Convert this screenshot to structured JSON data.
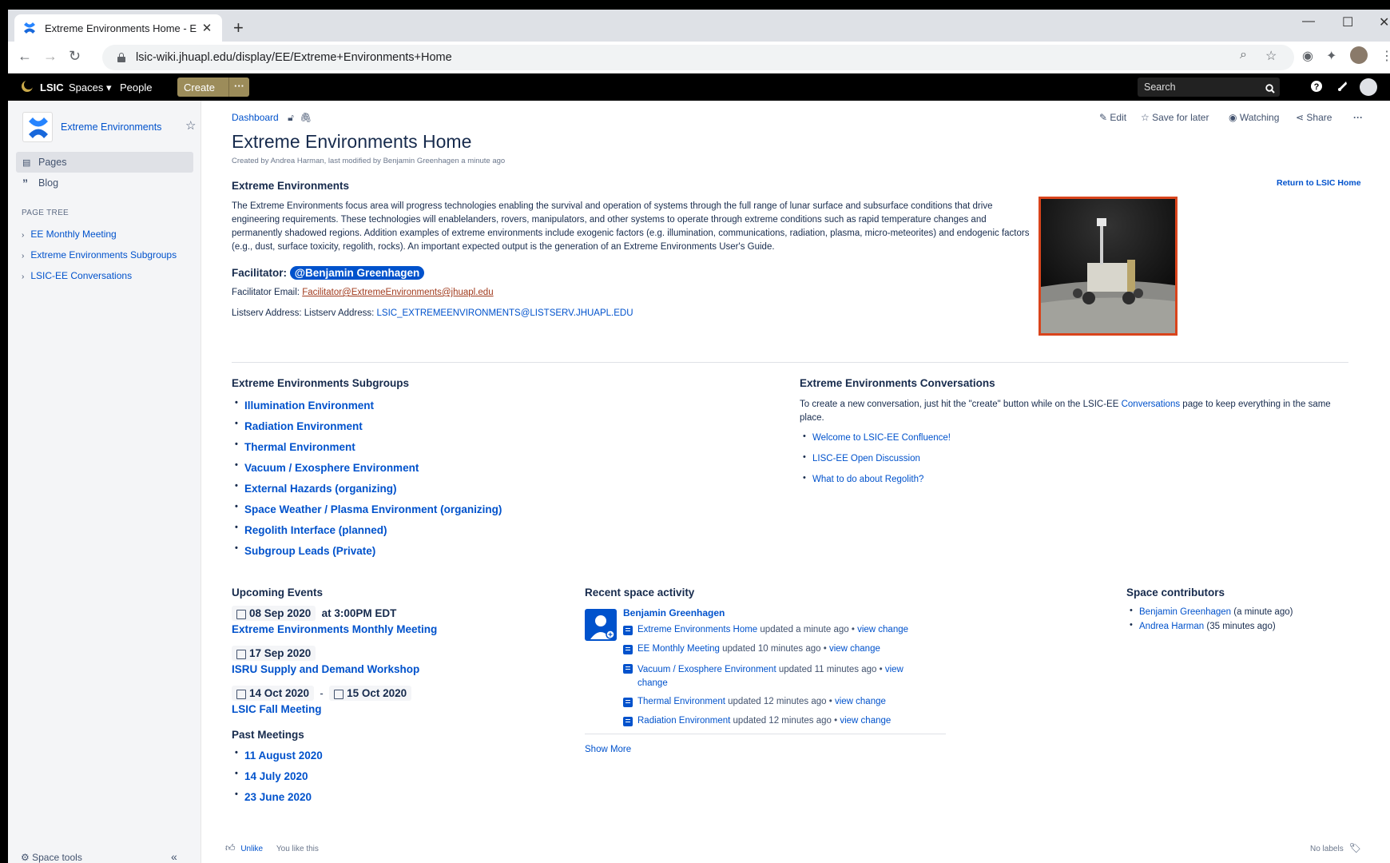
{
  "browser": {
    "tab_title": "Extreme Environments Home - E",
    "url": "lsic-wiki.jhuapl.edu/display/EE/Extreme+Environments+Home"
  },
  "topnav": {
    "logo_text": "LSIC",
    "spaces": "Spaces",
    "people": "People",
    "create": "Create",
    "more": "···",
    "search_placeholder": "Search"
  },
  "sidebar": {
    "space_name": "Extreme Environments",
    "pages": "Pages",
    "blog": "Blog",
    "page_tree_heading": "PAGE TREE",
    "tree": [
      "EE Monthly Meeting",
      "Extreme Environments Subgroups",
      "LSIC-EE Conversations"
    ],
    "space_tools": "Space tools"
  },
  "page": {
    "breadcrumb": "Dashboard",
    "tools": {
      "edit": "Edit",
      "save": "Save for later",
      "watch": "Watching",
      "share": "Share",
      "more": "···"
    },
    "title": "Extreme Environments Home",
    "byline": "Created by Andrea Harman, last modified by Benjamin Greenhagen a minute ago",
    "section_heading": "Extreme Environments",
    "return_link": "Return to LSIC Home",
    "description": "The Extreme Environments focus area will progress technologies enabling the survival and operation of systems through the full range of lunar surface and subsurface conditions that drive engineering requirements. These technologies will enablelanders, rovers, manipulators, and other systems to operate through extreme conditions such as rapid temperature changes and permanently shadowed regions. Addition examples of extreme environments include exogenic factors (e.g. illumination, communications, radiation, plasma, micro-meteorites) and endogenic factors (e.g., dust, surface toxicity, regolith, rocks). An important expected output is the generation of an Extreme Environments User's Guide.",
    "facilitator_label": "Facilitator:",
    "facilitator_mention": "@Benjamin Greenhagen",
    "facilitator_email_label": "Facilitator Email:",
    "facilitator_email": "Facilitator@ExtremeEnvironments@jhuapl.edu",
    "listserv_label": "Listserv Address: Listserv Address:",
    "listserv": "LSIC_EXTREMEENVIRONMENTS@LISTSERV.JHUAPL.EDU"
  },
  "subgroups": {
    "heading": "Extreme Environments Subgroups",
    "items": [
      "Illumination Environment",
      "Radiation Environment",
      "Thermal Environment",
      "Vacuum / Exosphere Environment",
      "External Hazards (organizing)",
      "Space Weather / Plasma Environment (organizing)",
      "Regolith Interface (planned)",
      "Subgroup Leads (Private)"
    ]
  },
  "conversations": {
    "heading": "Extreme Environments Conversations",
    "intro_a": "To create a new conversation, just hit the \"create\" button while on the LSIC-EE ",
    "intro_link": "Conversations",
    "intro_b": " page to keep everything in the same place.",
    "items": [
      "Welcome to LSIC-EE Confluence!",
      "LISC-EE Open Discussion",
      "What to do about Regolith?"
    ]
  },
  "events": {
    "heading": "Upcoming Events",
    "e1_date": "08 Sep 2020",
    "e1_time": "at 3:00PM EDT",
    "e1_title": "Extreme Environments Monthly Meeting",
    "e2_date": "17 Sep 2020",
    "e2_title": "ISRU Supply and Demand Workshop",
    "e3_date_start": "14 Oct 2020",
    "e3_sep": "-",
    "e3_date_end": "15 Oct 2020",
    "e3_title": "LSIC Fall Meeting",
    "past_heading": "Past Meetings",
    "past": [
      "11 August 2020",
      "14 July 2020",
      "23 June 2020"
    ]
  },
  "activity": {
    "heading": "Recent space activity",
    "user": "Benjamin Greenhagen",
    "rows": [
      {
        "page": "Extreme Environments Home",
        "when": " updated a minute ago • ",
        "action": "view change"
      },
      {
        "page": "EE Monthly Meeting",
        "when": " updated 10 minutes ago • ",
        "action": "view change"
      },
      {
        "page": "Vacuum / Exosphere Environment",
        "when": " updated 11 minutes ago • ",
        "action": "view change"
      },
      {
        "page": "Thermal Environment",
        "when": " updated 12 minutes ago • ",
        "action": "view change"
      },
      {
        "page": "Radiation Environment",
        "when": " updated 12 minutes ago • ",
        "action": "view change"
      }
    ],
    "show_more": "Show More"
  },
  "contributors": {
    "heading": "Space contributors",
    "items": [
      {
        "name": "Benjamin Greenhagen",
        "when": " (a minute ago)"
      },
      {
        "name": "Andrea Harman",
        "when": " (35 minutes ago)"
      }
    ]
  },
  "footer": {
    "like": "Unlike",
    "liked": "You like this",
    "labels": "No labels"
  },
  "colors": {
    "link": "#0052cc",
    "create_button": "#9c8c5a",
    "image_border": "#d9441c"
  }
}
